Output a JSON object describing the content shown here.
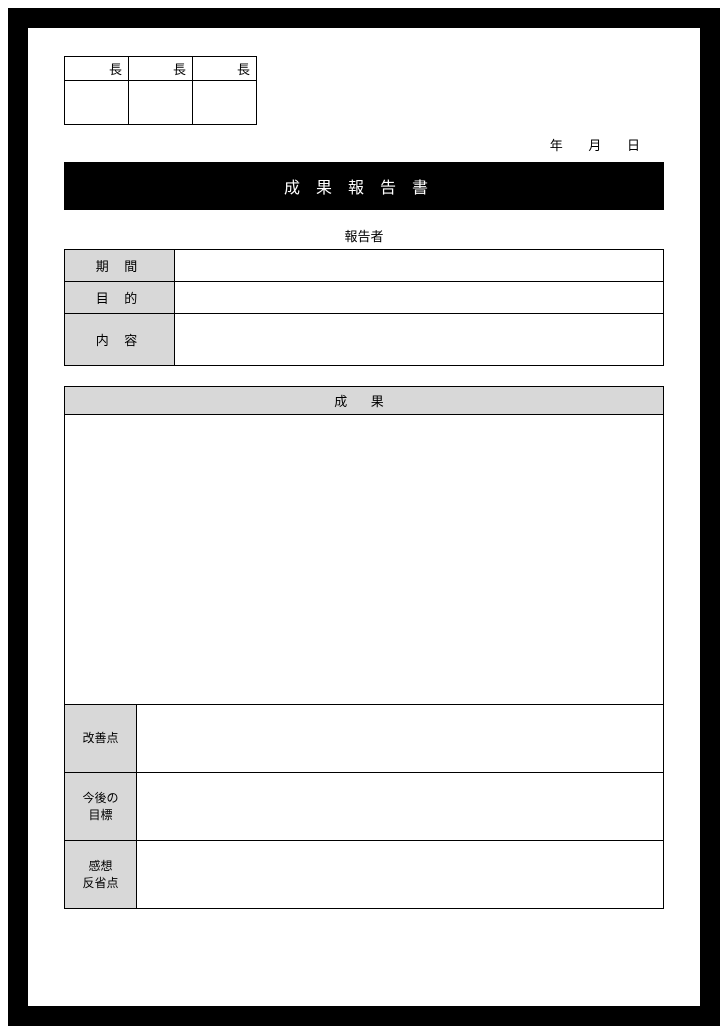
{
  "approval": {
    "col1": "長",
    "col2": "長",
    "col3": "長"
  },
  "date": {
    "year": "年",
    "month": "月",
    "day": "日"
  },
  "title": "成果報告書",
  "reporter_label": "報告者",
  "info": {
    "period_label": "期 間",
    "purpose_label": "目 的",
    "content_label": "内 容",
    "period_value": "",
    "purpose_value": "",
    "content_value": ""
  },
  "result": {
    "header": "成 果",
    "body": "",
    "improvement_label": "改善点",
    "improvement_value": "",
    "future_label_line1": "今後の",
    "future_label_line2": "目標",
    "future_value": "",
    "thoughts_label_line1": "感想",
    "thoughts_label_line2": "反省点",
    "thoughts_value": ""
  }
}
